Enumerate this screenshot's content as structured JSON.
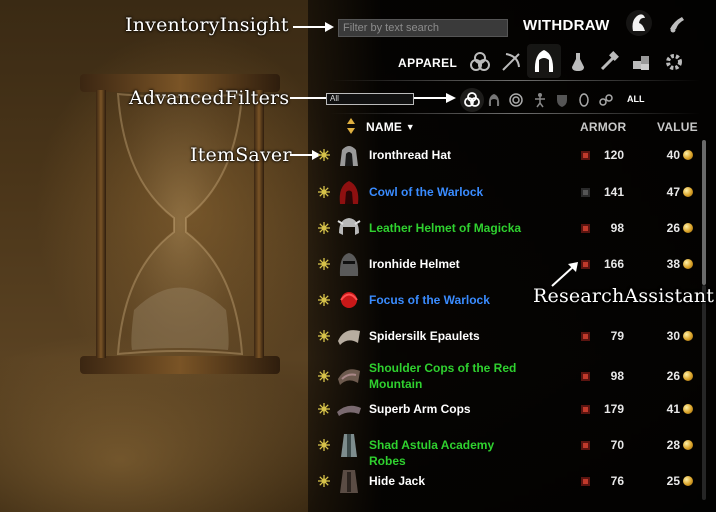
{
  "annotations": {
    "inventory_insight": "InventoryInsight",
    "advanced_filters": "AdvancedFilters",
    "item_saver": "ItemSaver",
    "research_assistant": "ResearchAssistant"
  },
  "header": {
    "search_placeholder": "Filter by text search",
    "mode_label": "WITHDRAW",
    "category_label": "APPAREL"
  },
  "advanced_filter": {
    "selected": "All",
    "all_label": "ALL"
  },
  "columns": {
    "name": "NAME",
    "armor": "ARMOR",
    "value": "VALUE"
  },
  "colors": {
    "common": "#ffffff",
    "superior": "#3a8cff",
    "fine": "#2fd12f",
    "research_marker": "#c0392b",
    "gold": "#d9a227"
  },
  "items": [
    {
      "name": "Ironthread Hat",
      "armor": "120",
      "value": "40",
      "quality": "common",
      "icon": "hat-icon",
      "researchable": true
    },
    {
      "name": "Cowl of the Warlock",
      "armor": "141",
      "value": "47",
      "quality": "superior",
      "icon": "cowl-icon",
      "researchable": false
    },
    {
      "name": "Leather Helmet of Magicka",
      "armor": "98",
      "value": "26",
      "quality": "fine",
      "icon": "leather-helmet-icon",
      "researchable": true
    },
    {
      "name": "Ironhide Helmet",
      "armor": "166",
      "value": "38",
      "quality": "common",
      "icon": "iron-helmet-icon",
      "researchable": true
    },
    {
      "name": "Focus of the Warlock",
      "armor": "",
      "value": "",
      "quality": "superior",
      "icon": "focus-icon",
      "researchable": false
    },
    {
      "name": "Spidersilk Epaulets",
      "armor": "79",
      "value": "30",
      "quality": "common",
      "icon": "epaulets-icon",
      "researchable": true
    },
    {
      "name": "Shoulder Cops of the Red Mountain",
      "armor": "98",
      "value": "26",
      "quality": "fine",
      "icon": "shoulder-cops-icon",
      "researchable": true
    },
    {
      "name": "Superb Arm Cops",
      "armor": "179",
      "value": "41",
      "quality": "common",
      "icon": "arm-cops-icon",
      "researchable": true
    },
    {
      "name": "Shad Astula Academy Robes",
      "armor": "70",
      "value": "28",
      "quality": "fine",
      "icon": "robes-icon",
      "researchable": true
    },
    {
      "name": "Hide Jack",
      "armor": "76",
      "value": "25",
      "quality": "common",
      "icon": "jack-icon",
      "researchable": true
    }
  ]
}
